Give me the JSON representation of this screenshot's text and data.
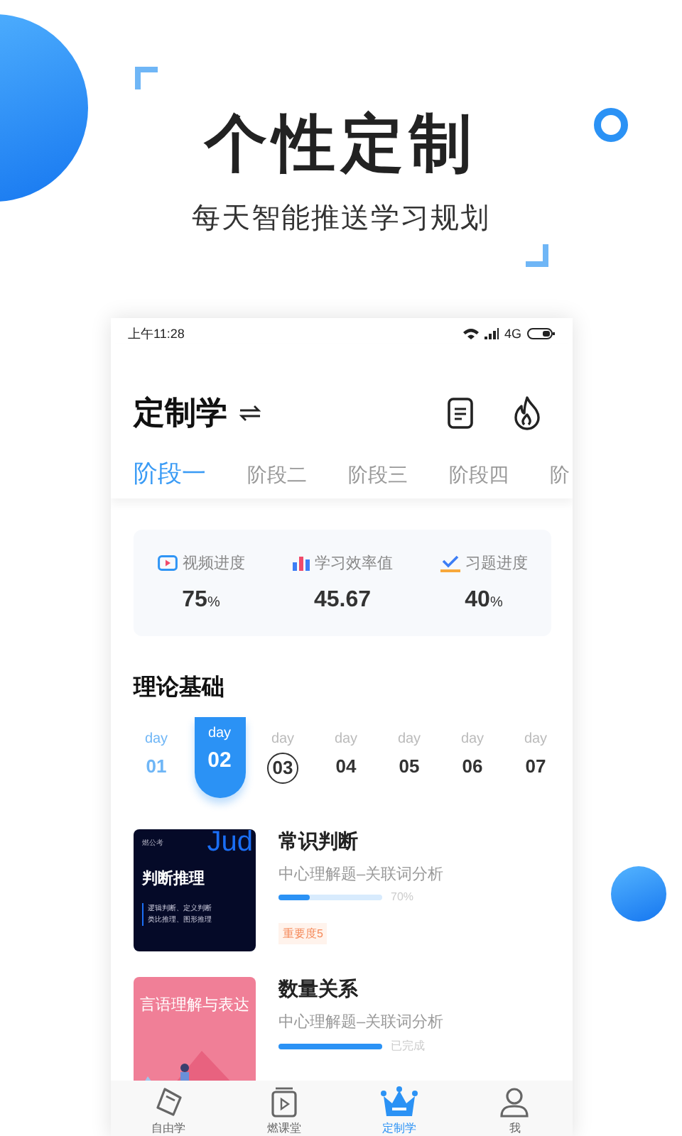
{
  "headline": "个性定制",
  "subheadline": "每天智能推送学习规划",
  "status_bar": {
    "time": "上午11:28",
    "network": "4G"
  },
  "header": {
    "title": "定制学"
  },
  "stage_tabs": [
    {
      "label": "阶段一",
      "selected": true
    },
    {
      "label": "阶段二",
      "selected": false
    },
    {
      "label": "阶段三",
      "selected": false
    },
    {
      "label": "阶段四",
      "selected": false
    },
    {
      "label": "阶",
      "selected": false
    }
  ],
  "stats": [
    {
      "kind": "video",
      "label": "视频进度",
      "value": "75",
      "unit": "%"
    },
    {
      "kind": "efficiency",
      "label": "学习效率值",
      "value": "45.67"
    },
    {
      "kind": "exercise",
      "label": "习题进度",
      "value": "40",
      "unit": "%"
    }
  ],
  "section_title": "理论基础",
  "days": [
    {
      "label": "day",
      "number": "01",
      "selected": false,
      "done": true,
      "today": false
    },
    {
      "label": "day",
      "number": "02",
      "selected": true,
      "done": true,
      "today": false
    },
    {
      "label": "day",
      "number": "03",
      "selected": false,
      "done": false,
      "today": true
    },
    {
      "label": "day",
      "number": "04",
      "selected": false,
      "done": false,
      "today": false
    },
    {
      "label": "day",
      "number": "05",
      "selected": false,
      "done": false,
      "today": false
    },
    {
      "label": "day",
      "number": "06",
      "selected": false,
      "done": false,
      "today": false
    },
    {
      "label": "day",
      "number": "07",
      "selected": false,
      "done": false,
      "today": false
    }
  ],
  "courses": [
    {
      "title": "常识判断",
      "subtitle": "中心理解题–关联词分析",
      "level": 0.3,
      "progress_text": "70%",
      "badge": "重要度5",
      "cover": {
        "kind": "dark",
        "brand": "燃公考",
        "word": "Jud",
        "title": "判断推理",
        "lines": [
          "逻辑判断、定义判断",
          "类比推理、图形推理"
        ]
      }
    },
    {
      "title": "数量关系",
      "subtitle": "中心理解题–关联词分析",
      "level": 1,
      "progress_text": "已完成",
      "cover": {
        "kind": "pink",
        "title": "言语理解与表达"
      }
    }
  ],
  "nav": [
    {
      "kind": "free",
      "label": "自由学",
      "selected": false
    },
    {
      "kind": "class",
      "label": "燃课堂",
      "selected": false
    },
    {
      "kind": "custom",
      "label": "定制学",
      "selected": true
    },
    {
      "kind": "me",
      "label": "我",
      "selected": false
    }
  ]
}
